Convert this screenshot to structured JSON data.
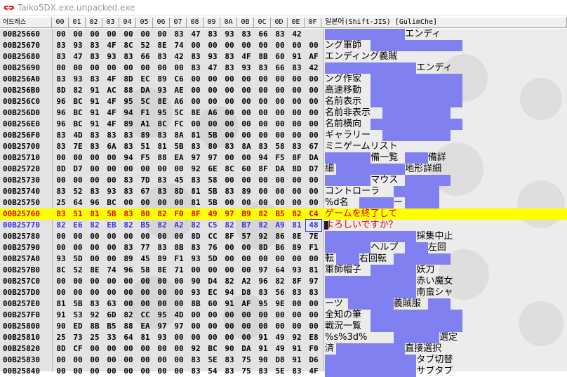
{
  "window": {
    "title": "Taiko5DX.exe.unpacked.exe",
    "icon": "app-logo-icon"
  },
  "columns": {
    "address": "어드레스",
    "hex": [
      "00",
      "01",
      "02",
      "03",
      "04",
      "05",
      "06",
      "07",
      "08",
      "09",
      "0A",
      "0B",
      "0C",
      "0D",
      "0E",
      "0F"
    ],
    "text": "일본어(Shift-JIS) [GulimChe]"
  },
  "colors": {
    "highlight": "#ffff00",
    "selected_text": "#e00000",
    "pending_hex": "#3232d8",
    "dot_fill": "#8080f0"
  },
  "selected_row": "00B25760",
  "rows": [
    {
      "addr": "00B25660",
      "hex": [
        "00",
        "00",
        "00",
        "00",
        "00",
        "00",
        "00",
        "83",
        "47",
        "83",
        "93",
        "83",
        "66",
        "83",
        "42",
        ""
      ],
      "spans": [
        [
          0,
          7,
          "",
          1
        ],
        [
          7,
          4,
          "エンディ",
          0
        ]
      ]
    },
    {
      "addr": "00B25670",
      "hex": [
        "83",
        "93",
        "83",
        "4F",
        "8C",
        "52",
        "8E",
        "74",
        "00",
        "00",
        "00",
        "00",
        "00",
        "00",
        "00",
        "00"
      ],
      "spans": [
        [
          0,
          4,
          "ング軍師",
          0
        ],
        [
          4,
          8,
          "",
          1
        ]
      ]
    },
    {
      "addr": "00B25680",
      "hex": [
        "83",
        "47",
        "83",
        "93",
        "83",
        "66",
        "83",
        "42",
        "83",
        "93",
        "83",
        "4F",
        "8B",
        "60",
        "91",
        "AF"
      ],
      "spans": [
        [
          0,
          8,
          "エンディング義賊",
          0
        ]
      ]
    },
    {
      "addr": "00B25690",
      "hex": [
        "00",
        "00",
        "00",
        "00",
        "00",
        "00",
        "00",
        "00",
        "83",
        "47",
        "83",
        "93",
        "83",
        "66",
        "83",
        "42"
      ],
      "spans": [
        [
          0,
          8,
          "",
          1
        ],
        [
          8,
          4,
          "エンディ",
          0
        ]
      ]
    },
    {
      "addr": "00B256A0",
      "hex": [
        "83",
        "93",
        "83",
        "4F",
        "8D",
        "EC",
        "89",
        "C6",
        "00",
        "00",
        "00",
        "00",
        "00",
        "00",
        "00",
        "00"
      ],
      "spans": [
        [
          0,
          4,
          "ング作家",
          0
        ],
        [
          4,
          8,
          "",
          1
        ]
      ]
    },
    {
      "addr": "00B256B0",
      "hex": [
        "8D",
        "82",
        "91",
        "AC",
        "88",
        "DA",
        "93",
        "AE",
        "00",
        "00",
        "00",
        "00",
        "00",
        "00",
        "00",
        "00"
      ],
      "spans": [
        [
          0,
          4,
          "高速移動",
          0
        ],
        [
          4,
          8,
          "",
          1
        ]
      ]
    },
    {
      "addr": "00B256C0",
      "hex": [
        "96",
        "BC",
        "91",
        "4F",
        "95",
        "5C",
        "8E",
        "A6",
        "00",
        "00",
        "00",
        "00",
        "00",
        "00",
        "00",
        "00"
      ],
      "spans": [
        [
          0,
          4,
          "名前表示",
          0
        ],
        [
          4,
          8,
          "",
          1
        ]
      ]
    },
    {
      "addr": "00B256D0",
      "hex": [
        "96",
        "BC",
        "91",
        "4F",
        "94",
        "F1",
        "95",
        "5C",
        "8E",
        "A6",
        "00",
        "00",
        "00",
        "00",
        "00",
        "00"
      ],
      "spans": [
        [
          0,
          5,
          "名前非表示",
          0
        ],
        [
          5,
          6,
          "",
          1
        ]
      ]
    },
    {
      "addr": "00B256E0",
      "hex": [
        "96",
        "BC",
        "91",
        "4F",
        "89",
        "A1",
        "8C",
        "FC",
        "00",
        "00",
        "00",
        "00",
        "00",
        "00",
        "00",
        "00"
      ],
      "spans": [
        [
          0,
          4,
          "名前横向",
          0
        ],
        [
          4,
          8,
          "",
          1
        ]
      ]
    },
    {
      "addr": "00B256F0",
      "hex": [
        "83",
        "4D",
        "83",
        "83",
        "83",
        "89",
        "83",
        "8A",
        "81",
        "5B",
        "00",
        "00",
        "00",
        "00",
        "00",
        "00"
      ],
      "spans": [
        [
          0,
          5,
          "ギャラリー",
          0
        ],
        [
          5,
          6,
          "",
          1
        ]
      ]
    },
    {
      "addr": "00B25700",
      "hex": [
        "83",
        "7E",
        "83",
        "6A",
        "83",
        "51",
        "81",
        "5B",
        "83",
        "80",
        "83",
        "8A",
        "83",
        "58",
        "83",
        "67"
      ],
      "spans": [
        [
          0,
          8,
          "ミニゲームリスト",
          0
        ]
      ]
    },
    {
      "addr": "00B25710",
      "hex": [
        "00",
        "00",
        "00",
        "00",
        "94",
        "F5",
        "88",
        "EA",
        "97",
        "97",
        "00",
        "00",
        "94",
        "F5",
        "8F",
        "DA"
      ],
      "spans": [
        [
          0,
          4,
          "",
          1
        ],
        [
          4,
          3,
          "備一覧",
          0
        ],
        [
          7,
          2,
          "",
          1
        ],
        [
          9,
          2,
          "備詳",
          0
        ]
      ]
    },
    {
      "addr": "00B25720",
      "hex": [
        "8D",
        "D7",
        "00",
        "00",
        "00",
        "00",
        "00",
        "00",
        "92",
        "6E",
        "8C",
        "60",
        "8F",
        "DA",
        "8D",
        "D7"
      ],
      "spans": [
        [
          0,
          1,
          "細",
          0
        ],
        [
          1,
          6,
          "",
          1
        ],
        [
          7,
          4,
          "地形詳細",
          0
        ]
      ]
    },
    {
      "addr": "00B25730",
      "hex": [
        "00",
        "00",
        "00",
        "00",
        "83",
        "7D",
        "83",
        "45",
        "83",
        "58",
        "00",
        "00",
        "00",
        "00",
        "00",
        "00"
      ],
      "spans": [
        [
          0,
          4,
          "",
          1
        ],
        [
          4,
          3,
          "マウス",
          0
        ],
        [
          7,
          4,
          "",
          1
        ]
      ]
    },
    {
      "addr": "00B25740",
      "hex": [
        "83",
        "52",
        "83",
        "93",
        "83",
        "67",
        "83",
        "8D",
        "81",
        "5B",
        "83",
        "89",
        "00",
        "00",
        "00",
        "00"
      ],
      "spans": [
        [
          0,
          6,
          "コントローラ",
          0
        ],
        [
          6,
          4,
          "",
          1
        ]
      ]
    },
    {
      "addr": "00B25750",
      "hex": [
        "25",
        "64",
        "96",
        "BC",
        "00",
        "00",
        "00",
        "00",
        "81",
        "5B",
        "00",
        "00",
        "00",
        "00",
        "00",
        "00"
      ],
      "spans": [
        [
          0,
          3,
          "%d名",
          0
        ],
        [
          3,
          3,
          "",
          1
        ],
        [
          6,
          1,
          "ー",
          0
        ],
        [
          7,
          3,
          "",
          1
        ]
      ]
    },
    {
      "addr": "00B25760",
      "hex": [
        "83",
        "51",
        "81",
        "5B",
        "83",
        "80",
        "82",
        "F0",
        "8F",
        "49",
        "97",
        "B9",
        "82",
        "B5",
        "82",
        "C4"
      ],
      "spans": [
        [
          0,
          8,
          "ゲームを終了して",
          0
        ]
      ]
    },
    {
      "addr": "00B25770",
      "hex": [
        "82",
        "E6",
        "82",
        "EB",
        "82",
        "B5",
        "82",
        "A2",
        "82",
        "C5",
        "82",
        "B7",
        "82",
        "A9",
        "81",
        "48"
      ],
      "spans": [
        [
          0,
          8,
          "よろしいですか？",
          0
        ]
      ]
    },
    {
      "addr": "00B25780",
      "hex": [
        "00",
        "00",
        "00",
        "00",
        "00",
        "00",
        "00",
        "00",
        "8D",
        "CC",
        "8F",
        "57",
        "92",
        "86",
        "8E",
        "7E"
      ],
      "spans": [
        [
          0,
          8,
          "",
          1
        ],
        [
          8,
          4,
          "採集中止",
          0
        ]
      ]
    },
    {
      "addr": "00B25790",
      "hex": [
        "00",
        "00",
        "00",
        "00",
        "83",
        "77",
        "83",
        "8B",
        "83",
        "76",
        "00",
        "00",
        "8D",
        "B6",
        "89",
        "F1"
      ],
      "spans": [
        [
          0,
          4,
          "",
          1
        ],
        [
          4,
          3,
          "ヘルプ",
          0
        ],
        [
          7,
          2,
          "",
          1
        ],
        [
          9,
          2,
          "左回",
          0
        ]
      ]
    },
    {
      "addr": "00B257A0",
      "hex": [
        "93",
        "5D",
        "00",
        "00",
        "89",
        "45",
        "89",
        "F1",
        "93",
        "5D",
        "00",
        "00",
        "00",
        "00",
        "00",
        "00"
      ],
      "spans": [
        [
          0,
          1,
          "転",
          0
        ],
        [
          1,
          2,
          "",
          1
        ],
        [
          3,
          3,
          "右回転",
          0
        ],
        [
          6,
          5,
          "",
          1
        ]
      ]
    },
    {
      "addr": "00B257B0",
      "hex": [
        "8C",
        "52",
        "8E",
        "74",
        "96",
        "58",
        "8E",
        "71",
        "00",
        "00",
        "00",
        "00",
        "97",
        "64",
        "93",
        "81"
      ],
      "spans": [
        [
          0,
          4,
          "軍師帽子",
          0
        ],
        [
          4,
          4,
          "",
          1
        ],
        [
          8,
          2,
          "妖刀",
          0
        ]
      ]
    },
    {
      "addr": "00B257C0",
      "hex": [
        "00",
        "00",
        "00",
        "00",
        "00",
        "00",
        "00",
        "00",
        "90",
        "D4",
        "82",
        "A2",
        "96",
        "82",
        "8F",
        "97"
      ],
      "spans": [
        [
          0,
          8,
          "",
          1
        ],
        [
          8,
          4,
          "赤い魔女",
          0
        ]
      ]
    },
    {
      "addr": "00B257D0",
      "hex": [
        "00",
        "00",
        "00",
        "00",
        "00",
        "00",
        "00",
        "00",
        "93",
        "EC",
        "94",
        "D8",
        "83",
        "56",
        "83",
        "83"
      ],
      "spans": [
        [
          0,
          8,
          "",
          1
        ],
        [
          8,
          4,
          "南蛮シャ",
          0
        ]
      ]
    },
    {
      "addr": "00B257E0",
      "hex": [
        "81",
        "5B",
        "83",
        "63",
        "00",
        "00",
        "00",
        "00",
        "8B",
        "60",
        "91",
        "AF",
        "95",
        "9E",
        "00",
        "00"
      ],
      "spans": [
        [
          0,
          2,
          "ーツ",
          0
        ],
        [
          2,
          4,
          "",
          1
        ],
        [
          6,
          3,
          "義賊服",
          0
        ],
        [
          9,
          2,
          "",
          1
        ]
      ]
    },
    {
      "addr": "00B257F0",
      "hex": [
        "91",
        "53",
        "92",
        "6D",
        "82",
        "CC",
        "95",
        "4D",
        "00",
        "00",
        "00",
        "00",
        "00",
        "00",
        "00",
        "00"
      ],
      "spans": [
        [
          0,
          4,
          "全知の筆",
          0
        ],
        [
          4,
          8,
          "",
          1
        ]
      ]
    },
    {
      "addr": "00B25800",
      "hex": [
        "90",
        "ED",
        "8B",
        "B5",
        "88",
        "EA",
        "97",
        "97",
        "00",
        "00",
        "00",
        "00",
        "00",
        "00",
        "00",
        "00"
      ],
      "spans": [
        [
          0,
          4,
          "戦況一覧",
          0
        ],
        [
          4,
          8,
          "",
          1
        ]
      ]
    },
    {
      "addr": "00B25810",
      "hex": [
        "25",
        "73",
        "25",
        "33",
        "64",
        "81",
        "93",
        "00",
        "00",
        "00",
        "00",
        "00",
        "91",
        "49",
        "92",
        "E8"
      ],
      "spans": [
        [
          0,
          6,
          "%s%3d%",
          0
        ],
        [
          6,
          4,
          "",
          1
        ],
        [
          10,
          2,
          "選定",
          0
        ]
      ]
    },
    {
      "addr": "00B25820",
      "hex": [
        "8D",
        "CF",
        "00",
        "00",
        "00",
        "00",
        "00",
        "00",
        "92",
        "BC",
        "90",
        "DA",
        "91",
        "49",
        "91",
        "F0"
      ],
      "spans": [
        [
          0,
          1,
          "済",
          0
        ],
        [
          1,
          6,
          "",
          1
        ],
        [
          7,
          4,
          "直接選択",
          0
        ]
      ]
    },
    {
      "addr": "00B25830",
      "hex": [
        "00",
        "00",
        "00",
        "00",
        "00",
        "00",
        "00",
        "00",
        "83",
        "5E",
        "83",
        "75",
        "90",
        "D8",
        "91",
        "D6"
      ],
      "spans": [
        [
          0,
          8,
          "",
          1
        ],
        [
          8,
          4,
          "タブ切替",
          0
        ]
      ]
    },
    {
      "addr": "00B25840",
      "hex": [
        "00",
        "00",
        "00",
        "00",
        "00",
        "00",
        "00",
        "00",
        "83",
        "54",
        "83",
        "75",
        "83",
        "5E",
        "83",
        "4F"
      ],
      "spans": [
        [
          0,
          8,
          "",
          1
        ],
        [
          8,
          4,
          "サブタブ",
          0
        ]
      ]
    }
  ]
}
